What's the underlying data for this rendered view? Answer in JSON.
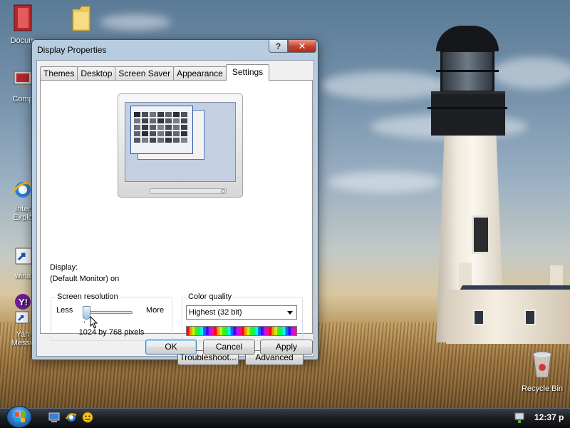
{
  "desktop": {
    "icons": [
      {
        "name": "my-documents",
        "label": "Docum"
      },
      {
        "name": "my-computer",
        "label": "Comp"
      },
      {
        "name": "internet-explorer",
        "label1": "Inter",
        "label2": "Explo"
      },
      {
        "name": "winamp",
        "label": "wina"
      },
      {
        "name": "yahoo-messenger",
        "label1": "Yah",
        "label2": "Messe"
      },
      {
        "name": "recycle-bin",
        "label": "Recycle Bin"
      }
    ]
  },
  "dialog": {
    "title": "Display Properties",
    "help_button": "?",
    "close_button": "✕",
    "tabs": [
      {
        "label": "Themes",
        "active": false
      },
      {
        "label": "Desktop",
        "active": false
      },
      {
        "label": "Screen Saver",
        "active": false
      },
      {
        "label": "Appearance",
        "active": false
      },
      {
        "label": "Settings",
        "active": true
      }
    ],
    "display_label": "Display:",
    "display_value": "(Default Monitor) on",
    "screen_resolution": {
      "title": "Screen resolution",
      "less": "Less",
      "more": "More",
      "value": "1024 by 768 pixels",
      "slider_position": 0.0
    },
    "color_quality": {
      "title": "Color quality",
      "selected": "Highest (32 bit)"
    },
    "buttons": {
      "troubleshoot": "Troubleshoot...",
      "advanced": "Advanced",
      "ok": "OK",
      "cancel": "Cancel",
      "apply": "Apply"
    }
  },
  "taskbar": {
    "clock": "12:37 p"
  },
  "colors": {
    "accent": "#2b57a5",
    "close_red": "#c7402e"
  }
}
